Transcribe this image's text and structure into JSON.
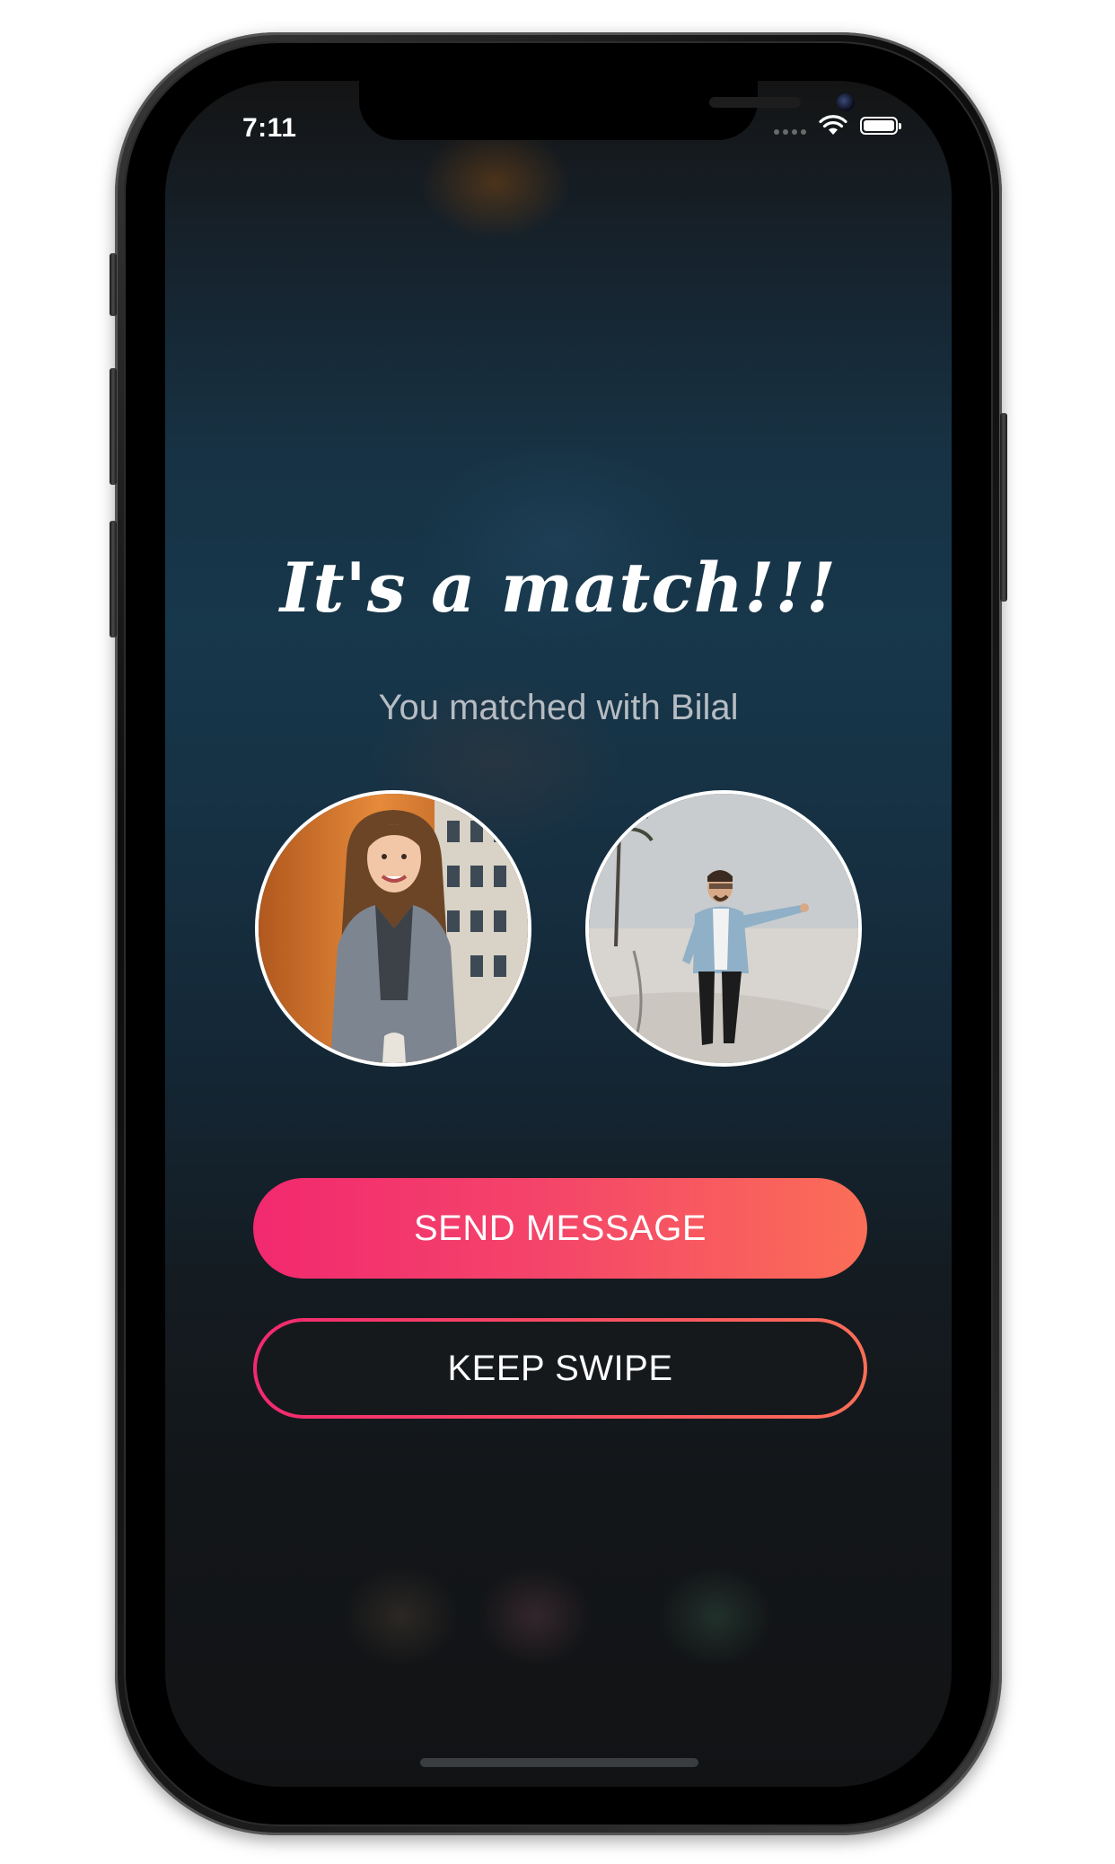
{
  "status_bar": {
    "time": "7:11",
    "icons": [
      "signal-dots-icon",
      "wifi-icon",
      "battery-icon"
    ]
  },
  "match": {
    "title": "It's a match!!!",
    "subtitle": "You matched with Bilal"
  },
  "avatars": {
    "left": "user-photo-woman",
    "right": "matched-photo-man-beach"
  },
  "actions": {
    "send_message_label": "SEND MESSAGE",
    "keep_swipe_label": "KEEP SWIPE"
  },
  "colors": {
    "accent_start": "#f2296f",
    "accent_end": "#fb6e57",
    "background": "#17374b",
    "subtitle_text": "#b6bcc2"
  }
}
